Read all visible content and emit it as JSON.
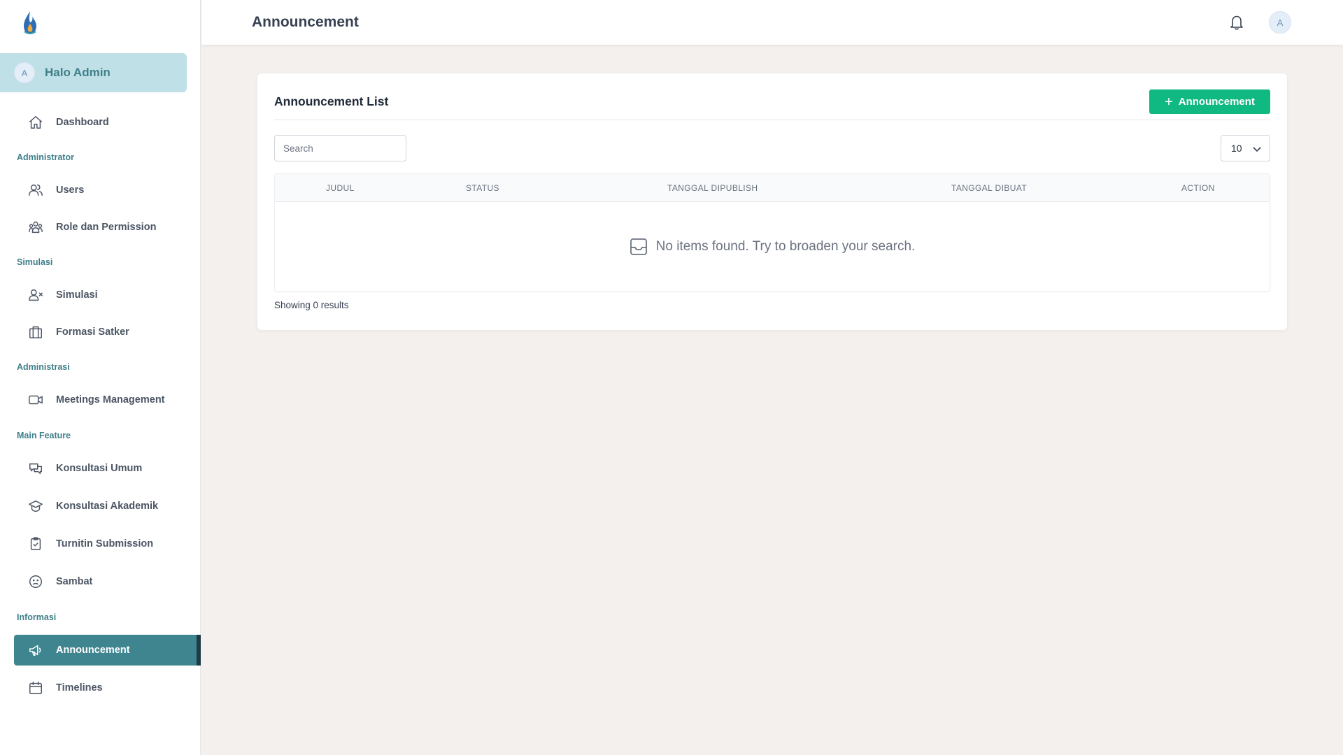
{
  "sidebar": {
    "user": {
      "avatar_initial": "A",
      "greeting": "Halo Admin"
    },
    "items": [
      {
        "label": "Dashboard",
        "icon": "home-icon"
      },
      {
        "section": "Administrator"
      },
      {
        "label": "Users",
        "icon": "users-icon"
      },
      {
        "label": "Role dan Permission",
        "icon": "user-group-icon"
      },
      {
        "section": "Simulasi"
      },
      {
        "label": "Simulasi",
        "icon": "user-remove-icon"
      },
      {
        "label": "Formasi Satker",
        "icon": "building-icon"
      },
      {
        "section": "Administrasi"
      },
      {
        "label": "Meetings Management",
        "icon": "video-camera-icon"
      },
      {
        "section": "Main Feature"
      },
      {
        "label": "Konsultasi Umum",
        "icon": "chat-icon"
      },
      {
        "label": "Konsultasi Akademik",
        "icon": "academic-cap-icon"
      },
      {
        "label": "Turnitin Submission",
        "icon": "clipboard-check-icon"
      },
      {
        "label": "Sambat",
        "icon": "emoji-sad-icon"
      },
      {
        "section": "Informasi"
      },
      {
        "label": "Announcement",
        "icon": "megaphone-icon",
        "active": true
      },
      {
        "label": "Timelines",
        "icon": "calendar-icon"
      }
    ]
  },
  "topbar": {
    "title": "Announcement",
    "avatar_initial": "A"
  },
  "card": {
    "title": "Announcement List",
    "add_button_label": "Announcement",
    "search_placeholder": "Search",
    "per_page": "10",
    "columns": [
      "JUDUL",
      "STATUS",
      "TANGGAL DIPUBLISH",
      "TANGGAL DIBUAT",
      "ACTION"
    ],
    "empty_message": "No items found. Try to broaden your search.",
    "results_text": "Showing 0 results"
  },
  "colors": {
    "accent": "#3f8590",
    "primary_button": "#10b981",
    "background": "#f4f0ee",
    "user_card": "#bfe0e6"
  }
}
